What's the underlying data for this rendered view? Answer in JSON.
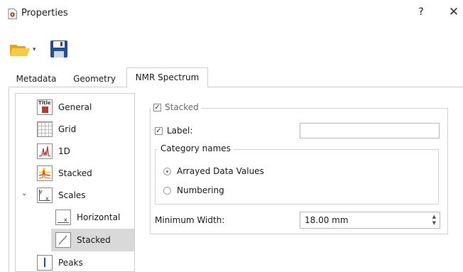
{
  "window": {
    "title": "Properties",
    "help": "?",
    "close": "✕"
  },
  "tabs": [
    {
      "label": "Metadata"
    },
    {
      "label": "Geometry"
    },
    {
      "label": "NMR Spectrum"
    }
  ],
  "tree": {
    "items": [
      {
        "label": "General"
      },
      {
        "label": "Grid"
      },
      {
        "label": "1D"
      },
      {
        "label": "Stacked"
      },
      {
        "label": "Scales"
      },
      {
        "label": "Horizontal"
      },
      {
        "label": "Stacked"
      },
      {
        "label": "Peaks"
      }
    ],
    "general_icon_text": "Title"
  },
  "panel": {
    "stacked_group": {
      "label": "Stacked",
      "checked": true
    },
    "label_checkbox": {
      "label": "Label:",
      "checked": true,
      "value": ""
    },
    "category_group": {
      "title": "Category names",
      "options": [
        {
          "label": "Arrayed Data Values",
          "selected": true
        },
        {
          "label": "Numbering",
          "selected": false
        }
      ]
    },
    "min_width": {
      "label": "Minimum Width:",
      "value": "18.00 mm"
    }
  },
  "colors": {
    "selection": "#d9d9d9",
    "folder": "#f0b429",
    "save": "#1f4f9c",
    "accent_red": "#c0392b"
  }
}
